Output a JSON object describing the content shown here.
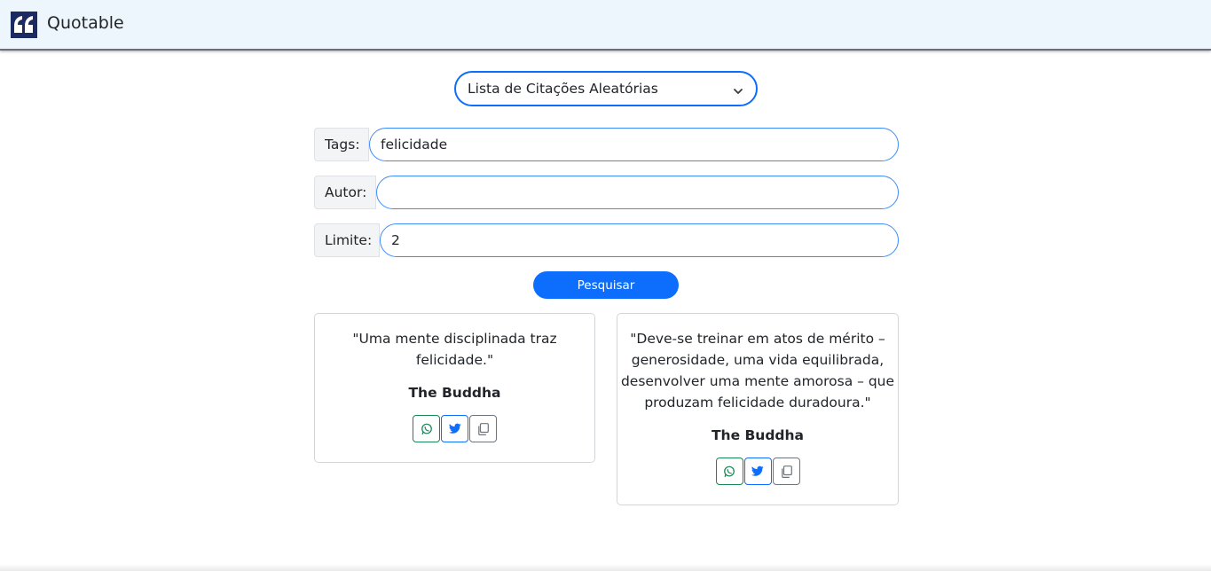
{
  "navbar": {
    "brand": "Quotable",
    "logo_icon": "quote-logo-icon"
  },
  "mode_select": {
    "selected": "Lista de Citações Aleatórias"
  },
  "form": {
    "tags": {
      "label": "Tags:",
      "value": "felicidade"
    },
    "author": {
      "label": "Autor:",
      "value": ""
    },
    "limit": {
      "label": "Limite:",
      "value": "2"
    },
    "search_label": "Pesquisar"
  },
  "quotes": [
    {
      "text_lines": [
        "\"Uma mente disciplinada traz",
        "felicidade.\""
      ],
      "author": "The Buddha"
    },
    {
      "text_lines": [
        "\"Deve-se treinar em atos de mérito –",
        "generosidade, uma vida equilibrada,",
        "desenvolver uma mente amorosa – que",
        "produzam felicidade duradoura.\""
      ],
      "author": "The Buddha"
    }
  ],
  "actions": {
    "whatsapp_icon": "whatsapp-icon",
    "twitter_icon": "twitter-icon",
    "copy_icon": "copy-icon"
  },
  "colors": {
    "primary": "#0d6efd",
    "success": "#198754",
    "secondary": "#6c757d",
    "navbar_bg": "#eef6fd",
    "logo_bg": "#1c2a64"
  }
}
